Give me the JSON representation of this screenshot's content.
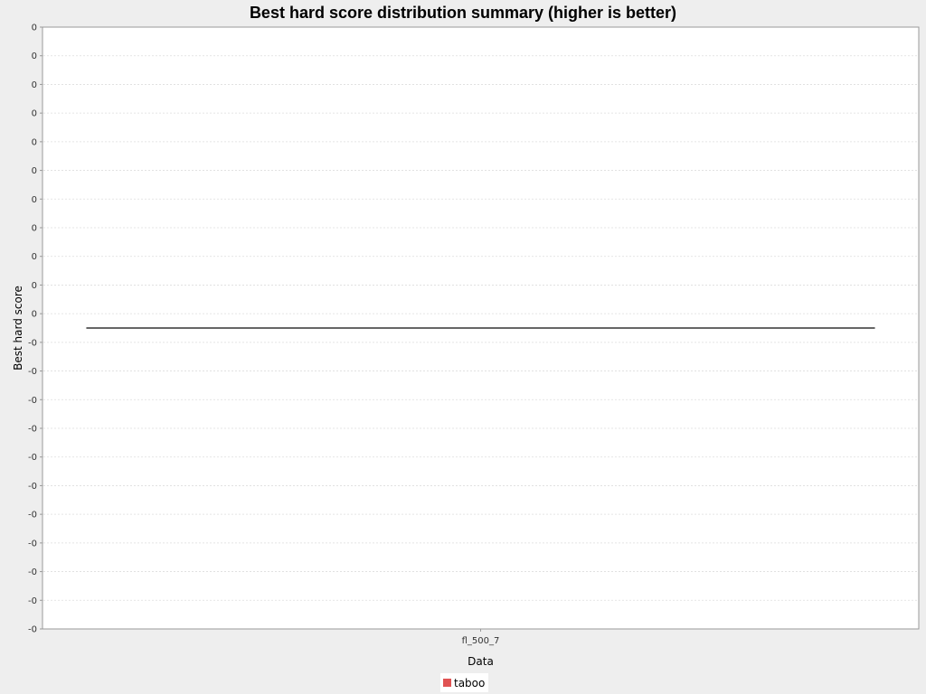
{
  "chart_data": {
    "type": "box",
    "title": "Best hard score distribution summary (higher is better)",
    "xlabel": "Data",
    "ylabel": "Best hard score",
    "categories": [
      "fl_500_7"
    ],
    "series": [
      {
        "name": "taboo",
        "color": "#e05252",
        "values": [
          {
            "category": "fl_500_7",
            "min": 0,
            "q1": 0,
            "median": 0,
            "q3": 0,
            "max": 0
          }
        ]
      }
    ],
    "y_tick_labels": [
      "0",
      "0",
      "0",
      "0",
      "0",
      "0",
      "0",
      "0",
      "0",
      "0",
      "0",
      "-0",
      "-0",
      "-0",
      "-0",
      "-0",
      "-0",
      "-0",
      "-0",
      "-0",
      "-0",
      "-0"
    ],
    "ylim": [
      -1e-07,
      1e-07
    ],
    "grid": true,
    "legend_position": "bottom"
  },
  "colors": {
    "page_background": "#eeeeee",
    "plot_background": "#ffffff",
    "gridline": "#dddddd",
    "median_line": "#333333"
  }
}
